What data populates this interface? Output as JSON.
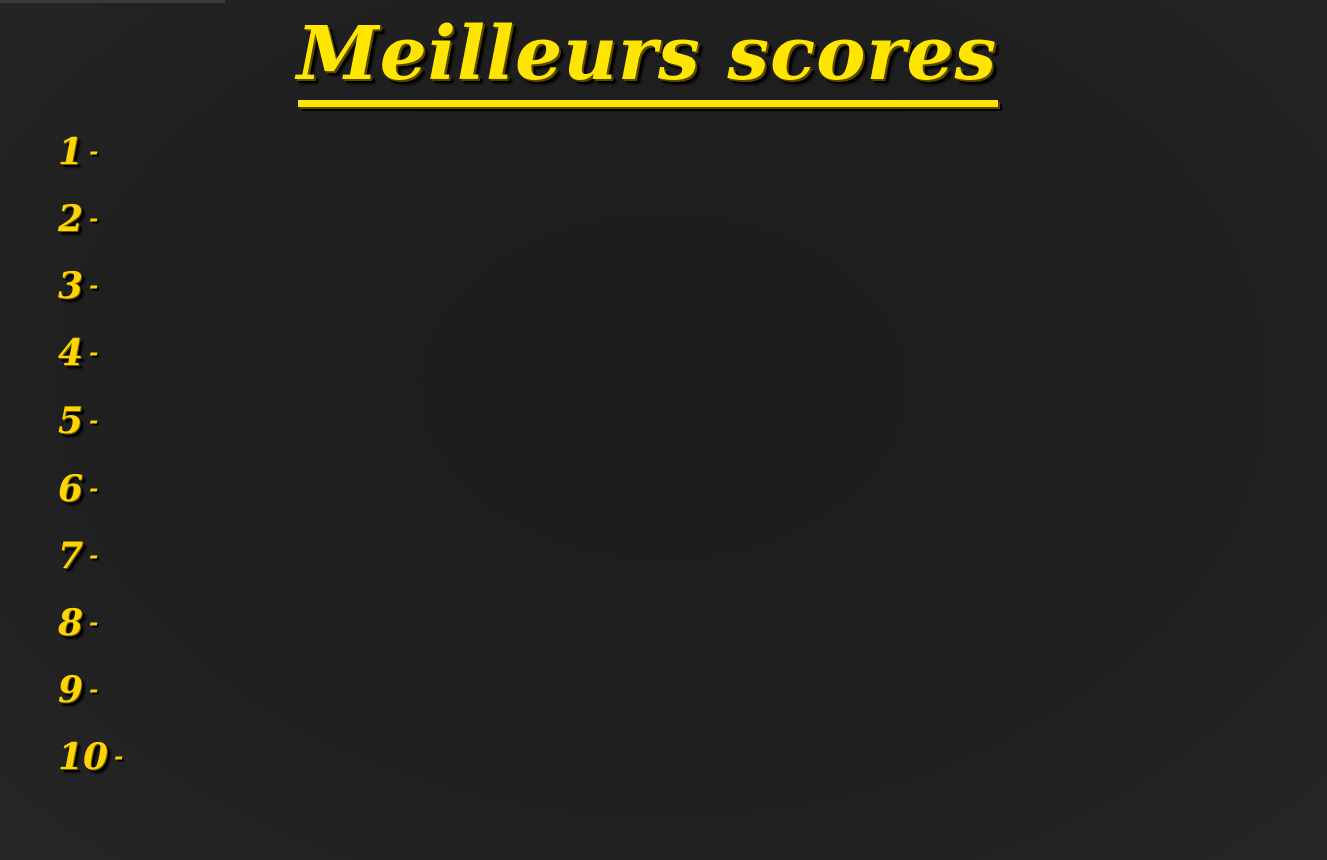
{
  "title": "Meilleurs scores",
  "colors": {
    "accent": "#ffe500",
    "background": "#1f1f1f"
  },
  "scores": [
    {
      "rank": "1",
      "separator": "-",
      "entry": ""
    },
    {
      "rank": "2",
      "separator": "-",
      "entry": ""
    },
    {
      "rank": "3",
      "separator": "-",
      "entry": ""
    },
    {
      "rank": "4",
      "separator": "-",
      "entry": ""
    },
    {
      "rank": "5",
      "separator": "-",
      "entry": ""
    },
    {
      "rank": "6",
      "separator": "-",
      "entry": ""
    },
    {
      "rank": "7",
      "separator": "-",
      "entry": ""
    },
    {
      "rank": "8",
      "separator": "-",
      "entry": ""
    },
    {
      "rank": "9",
      "separator": "-",
      "entry": ""
    },
    {
      "rank": "10",
      "separator": "-",
      "entry": ""
    }
  ]
}
